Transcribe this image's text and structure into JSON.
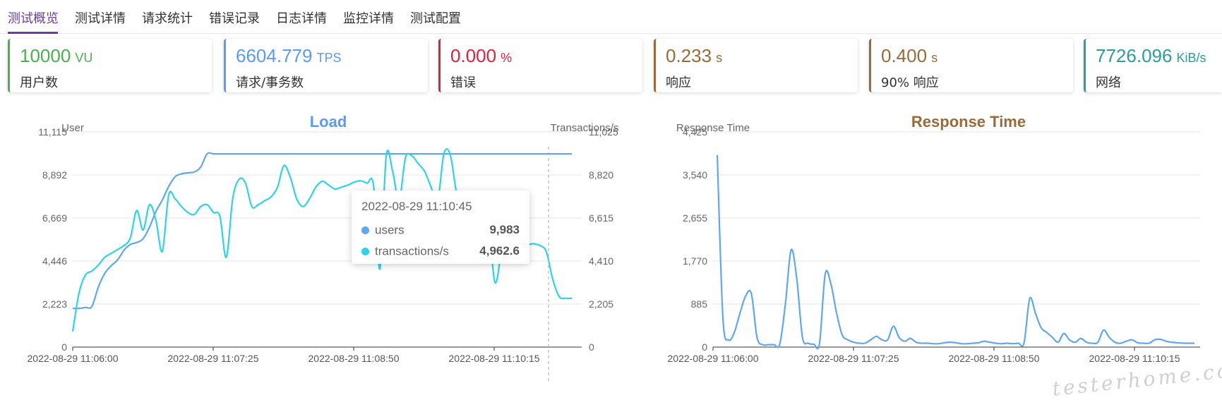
{
  "tabs": [
    "测试概览",
    "测试详情",
    "请求统计",
    "错误记录",
    "日志详情",
    "监控详情",
    "测试配置"
  ],
  "cards": [
    {
      "value": "10000",
      "unit": "VU",
      "label": "用户数",
      "color": "#4caf50"
    },
    {
      "value": "6604.779",
      "unit": "TPS",
      "label": "请求/事务数",
      "color": "#5b9bf5"
    },
    {
      "value": "0.000",
      "unit": "%",
      "label": "错误",
      "color": "#e0203c"
    },
    {
      "value": "0.233",
      "unit": "s",
      "label": "响应",
      "color": "#9a6b3a"
    },
    {
      "value": "0.400",
      "unit": "s",
      "label": "90% 响应",
      "color": "#9a6b3a"
    },
    {
      "value": "7726.096",
      "unit": "KiB/s",
      "label": "网络",
      "color": "#2a9d9d"
    }
  ],
  "tooltip": {
    "title": "2022-08-29 11:10:45",
    "rows": [
      {
        "name": "users",
        "value": "9,983",
        "color": "#5fa8f0"
      },
      {
        "name": "transactions/s",
        "value": "4,962.6",
        "color": "#2dd4e8"
      }
    ]
  },
  "watermark": "testerhome.com",
  "chart_data": [
    {
      "type": "line",
      "title": "Load",
      "title_color": "#5b9bf5",
      "ylabel": "User",
      "ylabel_right": "Transactions/s",
      "xticks": [
        "2022-08-29 11:06:00",
        "2022-08-29 11:07:25",
        "2022-08-29 11:08:50",
        "2022-08-29 11:10:15"
      ],
      "yticks_left": [
        "0",
        "2,223",
        "4,446",
        "6,669",
        "8,892",
        "11,115"
      ],
      "yticks_right": [
        "0",
        "2,205",
        "4,410",
        "6,615",
        "8,820",
        "11,025"
      ],
      "ylim_left": [
        0,
        11115
      ],
      "ylim_right": [
        0,
        11025
      ],
      "x": [
        0,
        2,
        4,
        6,
        8,
        10,
        12,
        14,
        16,
        18,
        20,
        22,
        24,
        26,
        28,
        30,
        32,
        34,
        36,
        38,
        40,
        42,
        44,
        46,
        48,
        50,
        52,
        54,
        56,
        58,
        60,
        62,
        64,
        66,
        68,
        70,
        72,
        74,
        76,
        78,
        80,
        82,
        84,
        86,
        88,
        90,
        92,
        94,
        96,
        98,
        100,
        102,
        104,
        106,
        108,
        110,
        112,
        114,
        116,
        118,
        120,
        122,
        124,
        126,
        128,
        130,
        132,
        134,
        136,
        138,
        140,
        142,
        144,
        146,
        148,
        150,
        152,
        154,
        156,
        158,
        160,
        162,
        164,
        166,
        168,
        170,
        172,
        174,
        176,
        178,
        180,
        182,
        184,
        186,
        188,
        190,
        192,
        194,
        196,
        198,
        200,
        202,
        204,
        206,
        208,
        210,
        212,
        214,
        216,
        218,
        220,
        222,
        224,
        226,
        228,
        230,
        232,
        234,
        236,
        238,
        240,
        242,
        244,
        246,
        248,
        250,
        252,
        254,
        256,
        258,
        260,
        262,
        264,
        266,
        268,
        270,
        272,
        274,
        276,
        278,
        280,
        282,
        284,
        286,
        288,
        290,
        292,
        294,
        296,
        298,
        300
      ],
      "xtick_positions": [
        0,
        85,
        170,
        255
      ],
      "series": [
        {
          "name": "users",
          "color": "#5fa8f0",
          "axis": "left",
          "values": [
            2000,
            2000,
            2050,
            2100,
            3100,
            3800,
            4200,
            4500,
            5000,
            5300,
            5400,
            5600,
            6200,
            7000,
            7600,
            8300,
            8800,
            8950,
            9000,
            9050,
            9300,
            9983,
            9983,
            9983,
            9983,
            9983,
            9983,
            9983,
            9983,
            9983,
            9983,
            9983,
            9983,
            9983,
            9983,
            9983,
            9983,
            9983,
            9983,
            9983,
            9983,
            9983,
            9983,
            9983,
            9983,
            9983,
            9983,
            9983,
            9983,
            9983,
            9983,
            9983,
            9983,
            9983,
            9983,
            9983,
            9983,
            9983,
            9983,
            9983,
            9983,
            9983,
            9983,
            9983,
            9983,
            9983,
            9983,
            9983,
            9983,
            9983,
            9983,
            9983,
            9983,
            9983,
            9983,
            9983,
            9983,
            9983,
            9983,
            9983,
            9983,
            9983,
            9983,
            9983,
            9983,
            9983,
            9983,
            9983,
            9983,
            9983,
            9983,
            9983,
            9983,
            9983,
            9983,
            9983,
            9983,
            9983,
            9983,
            9983,
            9983,
            9983,
            9983,
            9983,
            9983,
            9983,
            9983,
            9983,
            9983,
            9983,
            9983,
            9983,
            9983,
            9983,
            9983,
            9983,
            9983,
            9983,
            9983,
            9983,
            9983,
            9983,
            9983,
            9983,
            9983,
            9983,
            9983,
            9983,
            9983,
            9983,
            9983,
            9983,
            9983,
            9983,
            9983,
            9983,
            9983,
            9983,
            9983,
            9983,
            9983,
            9983,
            9983,
            9950,
            9850,
            9820,
            9983,
            9960,
            9983,
            9983,
            9983
          ]
        },
        {
          "name": "transactions/s",
          "color": "#2dd4e8",
          "axis": "right",
          "values": [
            800,
            2800,
            3700,
            3900,
            4200,
            4600,
            4800,
            5000,
            5200,
            5600,
            7000,
            6000,
            7300,
            6500,
            4900,
            7800,
            7600,
            7200,
            6900,
            6800,
            7200,
            7300,
            6900,
            6700,
            4600,
            7600,
            8600,
            8400,
            7200,
            7300,
            7500,
            7700,
            8200,
            9300,
            8700,
            7600,
            7200,
            7600,
            8200,
            8500,
            8300,
            8100,
            8200,
            8300,
            8450,
            8520,
            8400,
            8300,
            4000,
            9800,
            9000,
            7500,
            9700,
            9800,
            9400,
            9000,
            8200,
            7400,
            9900,
            9850,
            7900,
            7200,
            6000,
            5300,
            4962.6,
            6000,
            3300,
            5000,
            7200,
            6800,
            5900,
            5300,
            5300,
            5200,
            4900,
            3500,
            2600,
            2500,
            2500,
            2500,
            2500,
            2500,
            2500,
            2500,
            2500,
            2500,
            2500,
            2500,
            2500,
            2500,
            2500,
            2500,
            2500,
            2500,
            2500,
            2500,
            2500,
            2500,
            2500,
            2500,
            2500,
            2500,
            2500,
            2500,
            2500,
            2500,
            2500,
            2500,
            2500,
            2500,
            2500,
            2500,
            2500,
            2500,
            2500,
            2500,
            2500,
            2500,
            2500,
            2500,
            2500,
            2500,
            2500,
            2500,
            2500,
            2500,
            2500,
            2500,
            2500,
            2500,
            2500,
            2500,
            2500,
            2500,
            2500,
            2500,
            2500,
            2500,
            2500,
            2500,
            2500,
            2500,
            2500,
            2500,
            2500,
            2500,
            2500,
            2500,
            2500,
            2500
          ]
        }
      ]
    },
    {
      "type": "line",
      "title": "Response Time",
      "title_color": "#9a6b3a",
      "ylabel": "Response Time",
      "xticks": [
        "2022-08-29 11:06:00",
        "2022-08-29 11:07:25",
        "2022-08-29 11:08:50",
        "2022-08-29 11:10:15"
      ],
      "yticks_left": [
        "0",
        "885",
        "1,770",
        "2,655",
        "3,540",
        "4,425"
      ],
      "ylim_left": [
        0,
        4425
      ],
      "series": [
        {
          "name": "response time",
          "color": "#5fa8f0",
          "axis": "left",
          "values": [
            3950,
            600,
            150,
            300,
            700,
            1050,
            1100,
            200,
            50,
            50,
            50,
            60,
            900,
            2000,
            1400,
            200,
            80,
            60,
            80,
            1500,
            1300,
            700,
            250,
            150,
            100,
            80,
            80,
            150,
            220,
            150,
            150,
            430,
            200,
            120,
            180,
            100,
            80,
            80,
            70,
            70,
            90,
            100,
            90,
            70,
            70,
            80,
            90,
            120,
            100,
            80,
            70,
            80,
            70,
            80,
            90,
            1000,
            700,
            400,
            300,
            200,
            100,
            280,
            150,
            100,
            180,
            100,
            80,
            100,
            350,
            200,
            100,
            80,
            120,
            150,
            90,
            80,
            80,
            150,
            160,
            120,
            100,
            90,
            80,
            80,
            80
          ]
        }
      ]
    }
  ]
}
